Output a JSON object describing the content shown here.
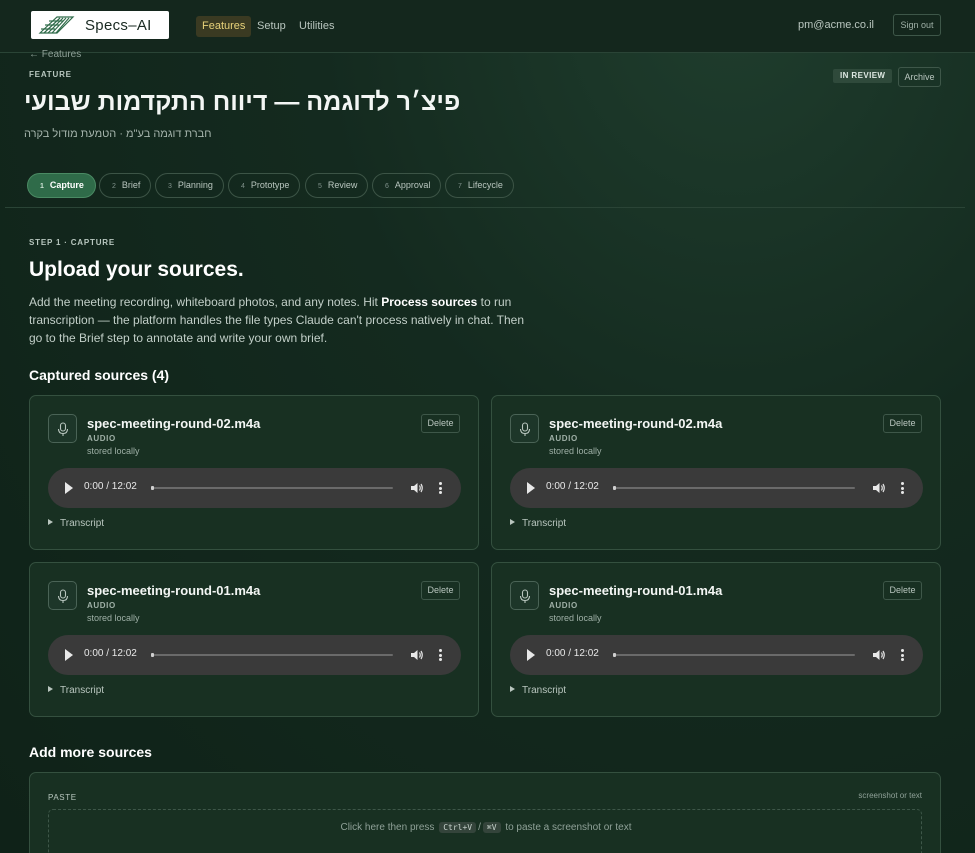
{
  "app": {
    "logo_text": "Specs–AI",
    "nav": [
      "Features",
      "Setup",
      "Utilities"
    ],
    "active_nav": "Features",
    "user_email": "pm@acme.co.il",
    "signout_label": "Sign out"
  },
  "feature": {
    "back_label": "← Features",
    "kicker": "FEATURE",
    "status": "IN REVIEW",
    "archive_label": "Archive",
    "title": "פיצ׳ר לדוגמה — דיווח התקדמות שבועי",
    "subtitle": "חברת דוגמה בע\"מ · הטמעת מודול בקרה"
  },
  "steps": [
    {
      "num": "1",
      "label": "Capture"
    },
    {
      "num": "2",
      "label": "Brief"
    },
    {
      "num": "3",
      "label": "Planning"
    },
    {
      "num": "4",
      "label": "Prototype"
    },
    {
      "num": "5",
      "label": "Review"
    },
    {
      "num": "6",
      "label": "Approval"
    },
    {
      "num": "7",
      "label": "Lifecycle"
    }
  ],
  "capture": {
    "kicker": "STEP 1 · CAPTURE",
    "title": "Upload your sources.",
    "desc_before": "Add the meeting recording, whiteboard photos, and any notes. Hit ",
    "desc_bold": "Process sources",
    "desc_after": " to run transcription — the platform handles the file types Claude can't process natively in chat. Then go to the Brief step to annotate and write your own brief.",
    "captured_title": "Captured sources (4)"
  },
  "sources": [
    {
      "name": "spec-meeting-round-02.m4a",
      "type": "AUDIO",
      "storage": "stored locally",
      "delete_label": "Delete",
      "time": "0:00 / 12:02",
      "progress": 0.0,
      "transcript_label": "Transcript"
    },
    {
      "name": "spec-meeting-round-02.m4a",
      "type": "AUDIO",
      "storage": "stored locally",
      "delete_label": "Delete",
      "time": "0:00 / 12:02",
      "progress": 0.0,
      "transcript_label": "Transcript"
    },
    {
      "name": "spec-meeting-round-01.m4a",
      "type": "AUDIO",
      "storage": "stored locally",
      "delete_label": "Delete",
      "time": "0:00 / 12:02",
      "progress": 0.0,
      "transcript_label": "Transcript"
    },
    {
      "name": "spec-meeting-round-01.m4a",
      "type": "AUDIO",
      "storage": "stored locally",
      "delete_label": "Delete",
      "time": "0:00 / 12:02",
      "progress": 0.0,
      "transcript_label": "Transcript"
    }
  ],
  "more": {
    "title": "Add more sources",
    "paste_label": "PASTE",
    "paste_hint": "screenshot or text",
    "paste_before": "Click here then press",
    "paste_key1": "Ctrl+V",
    "paste_sep": "/",
    "paste_key2": "⌘V",
    "paste_after": "to paste a screenshot or text"
  },
  "icons": {
    "logo": "leaf-logo-icon",
    "source": "microphone-icon",
    "play": "play-icon",
    "volume": "volume-icon",
    "menu": "more-vertical-icon",
    "disclosure": "triangle-right-icon"
  },
  "colors": {
    "accent": "#2f6b49",
    "nav_active": "#e8d27a",
    "background": "#142a1f"
  }
}
